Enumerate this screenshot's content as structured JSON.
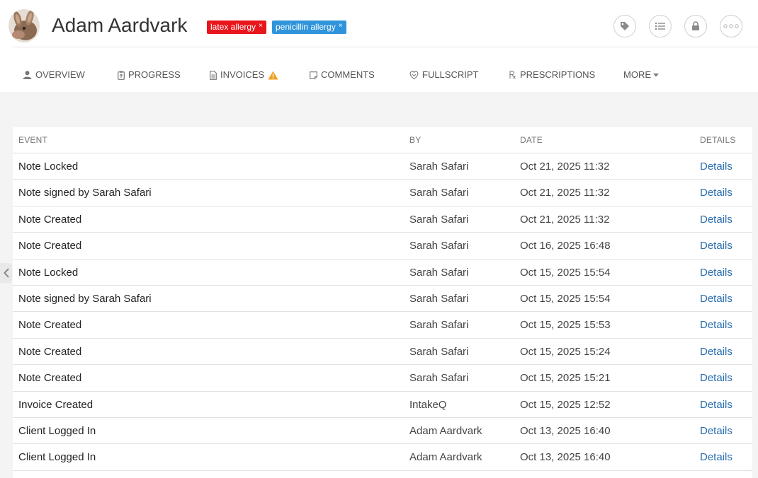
{
  "client": {
    "name": "Adam Aardvark",
    "tags": [
      {
        "label": "latex allergy",
        "remove": "×",
        "color": "#e8151b"
      },
      {
        "label": "penicillin allergy",
        "remove": "×",
        "color": "#2f94db"
      }
    ]
  },
  "header_buttons": [
    "tag-icon",
    "checklist-icon",
    "lock-icon",
    "more-dots-icon"
  ],
  "nav": {
    "tabs": [
      {
        "label": "OVERVIEW",
        "icon": "user-icon"
      },
      {
        "label": "PROGRESS",
        "icon": "clipboard-icon"
      },
      {
        "label": "INVOICES",
        "icon": "document-icon",
        "badge": "warning-icon"
      },
      {
        "label": "COMMENTS",
        "icon": "comment-icon"
      },
      {
        "label": "FULLSCRIPT",
        "icon": "fullscript-icon"
      },
      {
        "label": "PRESCRIPTIONS",
        "icon": "rx-icon"
      },
      {
        "label": "MORE",
        "icon": "caret-down-icon"
      }
    ]
  },
  "table": {
    "headers": {
      "event": "EVENT",
      "by": "BY",
      "date": "DATE",
      "details": "DETAILS"
    },
    "rows": [
      {
        "event": "Note Locked",
        "by": "Sarah Safari",
        "date": "Oct 21, 2025 11:32",
        "details": "Details"
      },
      {
        "event": "Note signed by Sarah Safari",
        "by": "Sarah Safari",
        "date": "Oct 21, 2025 11:32",
        "details": "Details"
      },
      {
        "event": "Note Created",
        "by": "Sarah Safari",
        "date": "Oct 21, 2025 11:32",
        "details": "Details"
      },
      {
        "event": "Note Created",
        "by": "Sarah Safari",
        "date": "Oct 16, 2025 16:48",
        "details": "Details"
      },
      {
        "event": "Note Locked",
        "by": "Sarah Safari",
        "date": "Oct 15, 2025 15:54",
        "details": "Details"
      },
      {
        "event": "Note signed by Sarah Safari",
        "by": "Sarah Safari",
        "date": "Oct 15, 2025 15:54",
        "details": "Details"
      },
      {
        "event": "Note Created",
        "by": "Sarah Safari",
        "date": "Oct 15, 2025 15:53",
        "details": "Details"
      },
      {
        "event": "Note Created",
        "by": "Sarah Safari",
        "date": "Oct 15, 2025 15:24",
        "details": "Details"
      },
      {
        "event": "Note Created",
        "by": "Sarah Safari",
        "date": "Oct 15, 2025 15:21",
        "details": "Details"
      },
      {
        "event": "Invoice Created",
        "by": "IntakeQ",
        "date": "Oct 15, 2025 12:52",
        "details": "Details"
      },
      {
        "event": "Client Logged In",
        "by": "Adam Aardvark",
        "date": "Oct 13, 2025 16:40",
        "details": "Details"
      },
      {
        "event": "Client Logged In",
        "by": "Adam Aardvark",
        "date": "Oct 13, 2025 16:40",
        "details": "Details"
      }
    ]
  },
  "colors": {
    "link": "#2a6eb0",
    "warning": "#f0a020",
    "tag_red": "#e8151b",
    "tag_blue": "#2f94db"
  }
}
